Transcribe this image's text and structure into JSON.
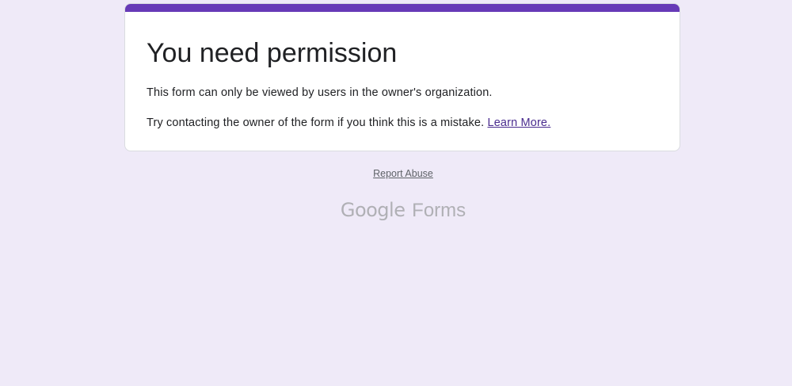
{
  "card": {
    "title": "You need permission",
    "message": "This form can only be viewed by users in the owner's organization.",
    "contact_text": "Try contacting the owner of the form if you think this is a mistake.",
    "learn_more_label": "Learn More."
  },
  "footer": {
    "report_abuse_label": "Report Abuse",
    "brand_google": "Google",
    "brand_product": "Forms"
  },
  "colors": {
    "page_background": "#efeaf8",
    "accent": "#673ab7",
    "link": "#4a2c8f",
    "brand_text": "#b0b0b5"
  }
}
